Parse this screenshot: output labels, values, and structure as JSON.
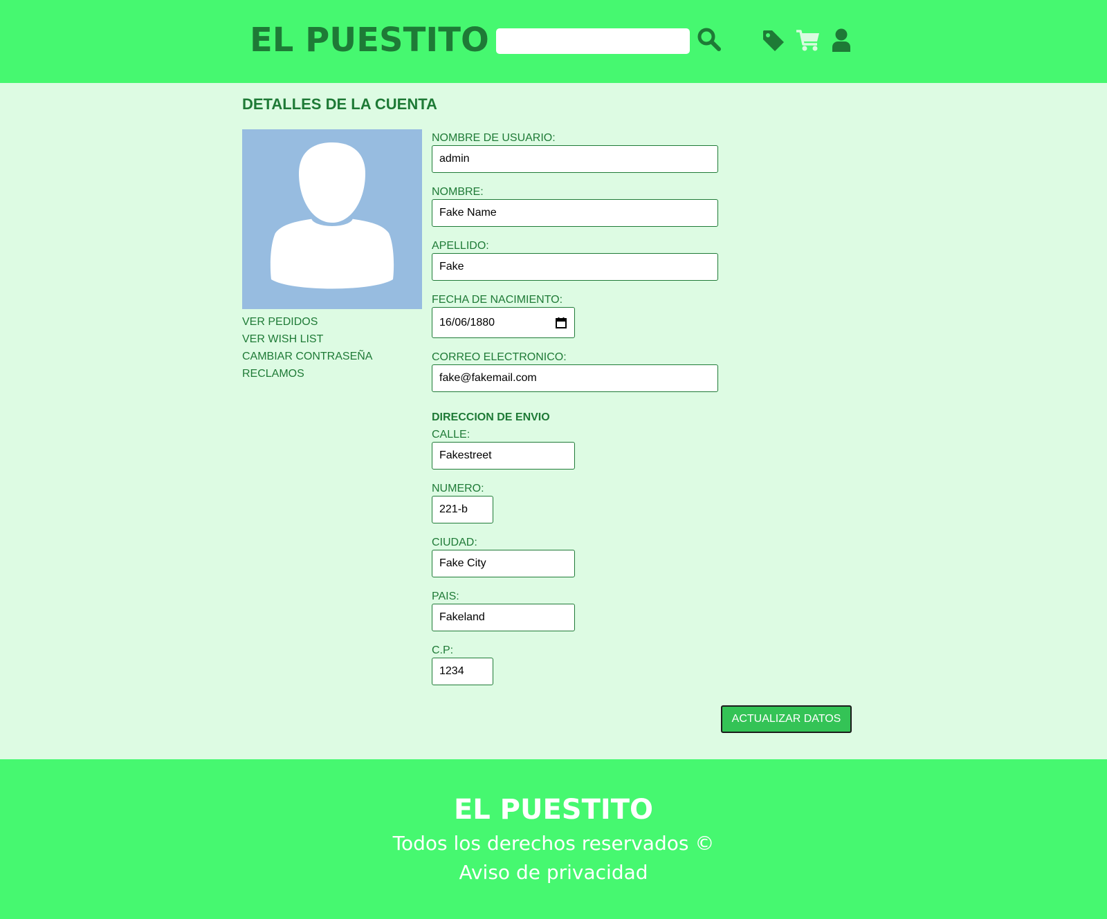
{
  "header": {
    "brand": "EL PUESTITO",
    "search": {
      "value": "",
      "placeholder": ""
    },
    "icons": [
      "search-icon",
      "tag-icon",
      "cart-icon",
      "user-icon"
    ]
  },
  "page": {
    "title": "DETALLES DE LA CUENTA"
  },
  "sidebar": {
    "links": [
      {
        "label": "VER PEDIDOS"
      },
      {
        "label": "VER WISH LIST"
      },
      {
        "label": "CAMBIAR CONTRASEÑA"
      },
      {
        "label": "RECLAMOS"
      }
    ]
  },
  "form": {
    "username": {
      "label": "NOMBRE DE USUARIO:",
      "value": "admin"
    },
    "first_name": {
      "label": "NOMBRE:",
      "value": "Fake Name"
    },
    "last_name": {
      "label": "APELLIDO:",
      "value": "Fake"
    },
    "birth_date": {
      "label": "FECHA DE NACIMIENTO:",
      "value": "16/06/1880"
    },
    "email": {
      "label": "CORREO ELECTRONICO:",
      "value": "fake@fakemail.com"
    },
    "shipping_title": "DIRECCION DE ENVIO",
    "street": {
      "label": "CALLE:",
      "value": "Fakestreet"
    },
    "number": {
      "label": "NUMERO:",
      "value": "221-b"
    },
    "city": {
      "label": "CIUDAD:",
      "value": "Fake City"
    },
    "country": {
      "label": "PAIS:",
      "value": "Fakeland"
    },
    "zip": {
      "label": "C.P:",
      "value": "1234"
    },
    "submit_label": "ACTUALIZAR DATOS"
  },
  "footer": {
    "brand": "EL PUESTITO",
    "rights": "Todos los derechos reservados ©",
    "privacy": "Aviso de privacidad"
  },
  "colors": {
    "header_bg": "#46f870",
    "page_bg": "#ddfbe3",
    "text_green": "#1e7a36",
    "avatar_bg": "#97bce0",
    "button_bg": "#34c356"
  }
}
